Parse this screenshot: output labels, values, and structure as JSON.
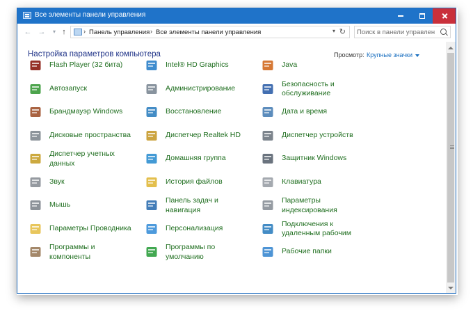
{
  "window": {
    "title": "Все элементы панели управления"
  },
  "address": {
    "crumbs": [
      "Панель управления",
      "Все элементы панели управления"
    ]
  },
  "search": {
    "placeholder": "Поиск в панели управления"
  },
  "content": {
    "heading": "Настройка параметров компьютера",
    "view_label": "Просмотр:",
    "view_value": "Крупные значки"
  },
  "items": [
    {
      "label": "Flash Player (32 бита)",
      "icon": "flash-player-icon",
      "color": "#8a1a0f"
    },
    {
      "label": "Intel® HD Graphics",
      "icon": "intel-graphics-icon",
      "color": "#2a7fc9"
    },
    {
      "label": "Java",
      "icon": "java-icon",
      "color": "#d2691e"
    },
    {
      "label": "Автозапуск",
      "icon": "autoplay-icon",
      "color": "#3a9a3a"
    },
    {
      "label": "Администрирование",
      "icon": "administrative-tools-icon",
      "color": "#7b8794"
    },
    {
      "label": "Безопасность и обслуживание",
      "icon": "security-flag-icon",
      "color": "#2f5fa8"
    },
    {
      "label": "Брандмауэр Windows",
      "icon": "firewall-icon",
      "color": "#a0522d"
    },
    {
      "label": "Восстановление",
      "icon": "recovery-icon",
      "color": "#2f7fbf"
    },
    {
      "label": "Дата и время",
      "icon": "date-time-icon",
      "color": "#4a7fb5"
    },
    {
      "label": "Дисковые пространства",
      "icon": "storage-spaces-icon",
      "color": "#808890"
    },
    {
      "label": "Диспетчер Realtek HD",
      "icon": "realtek-icon",
      "color": "#c79a2b"
    },
    {
      "label": "Диспетчер устройств",
      "icon": "device-manager-icon",
      "color": "#6e7780"
    },
    {
      "label": "Диспетчер учетных данных",
      "icon": "credential-manager-icon",
      "color": "#c7a02a"
    },
    {
      "label": "Домашняя группа",
      "icon": "homegroup-icon",
      "color": "#2f8fd0"
    },
    {
      "label": "Защитник Windows",
      "icon": "windows-defender-icon",
      "color": "#5a6470"
    },
    {
      "label": "Звук",
      "icon": "sound-icon",
      "color": "#8a8f96"
    },
    {
      "label": "История файлов",
      "icon": "file-history-icon",
      "color": "#e0b83a"
    },
    {
      "label": "Клавиатура",
      "icon": "keyboard-icon",
      "color": "#9aa0a6"
    },
    {
      "label": "Мышь",
      "icon": "mouse-icon",
      "color": "#7f868d"
    },
    {
      "label": "Панель задач и навигация",
      "icon": "taskbar-icon",
      "color": "#2f6fb0"
    },
    {
      "label": "Параметры индексирования",
      "icon": "indexing-options-icon",
      "color": "#8a9098"
    },
    {
      "label": "Параметры Проводника",
      "icon": "file-explorer-options-icon",
      "color": "#e6c04a"
    },
    {
      "label": "Персонализация",
      "icon": "personalization-icon",
      "color": "#3a8fd8"
    },
    {
      "label": "Подключения к удаленным рабочим",
      "icon": "remote-desktop-icon",
      "color": "#2f7fbf"
    },
    {
      "label": "Программы и компоненты",
      "icon": "programs-features-icon",
      "color": "#9a7b5a"
    },
    {
      "label": "Программы по умолчанию",
      "icon": "default-programs-icon",
      "color": "#2e9e3e"
    },
    {
      "label": "Рабочие папки",
      "icon": "work-folders-icon",
      "color": "#3a88d0"
    }
  ]
}
